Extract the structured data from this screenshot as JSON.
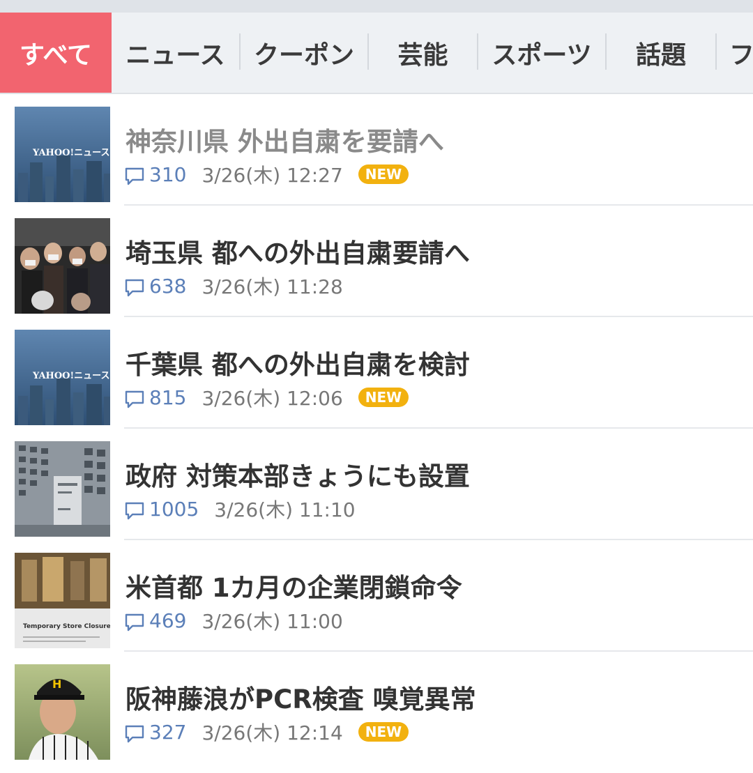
{
  "tabs": [
    {
      "label": "すべて",
      "active": true
    },
    {
      "label": "ニュース"
    },
    {
      "label": "クーポン"
    },
    {
      "label": "芸能"
    },
    {
      "label": "スポーツ"
    },
    {
      "label": "話題"
    },
    {
      "label": "フ"
    }
  ],
  "articles": [
    {
      "title": "神奈川県 外出自粛を要請へ",
      "comments": "310",
      "date": "3/26(木) 12:27",
      "badge": "NEW",
      "read": true,
      "thumb": "yahoo-news-city-thumbnail",
      "thumb_text": "YAHOO!ニュース"
    },
    {
      "title": "埼玉県 都への外出自粛要請へ",
      "comments": "638",
      "date": "3/26(木) 11:28",
      "badge": "",
      "read": false,
      "thumb": "crowd-photo-thumbnail"
    },
    {
      "title": "千葉県 都への外出自粛を検討",
      "comments": "815",
      "date": "3/26(木) 12:06",
      "badge": "NEW",
      "read": false,
      "thumb": "yahoo-news-city-thumbnail",
      "thumb_text": "YAHOO!ニュース"
    },
    {
      "title": "政府 対策本部きょうにも設置",
      "comments": "1005",
      "date": "3/26(木) 11:10",
      "badge": "",
      "read": false,
      "thumb": "government-building-thumbnail"
    },
    {
      "title": "米首都 1カ月の企業閉鎖命令",
      "comments": "469",
      "date": "3/26(木) 11:00",
      "badge": "",
      "read": false,
      "thumb": "store-closure-thumbnail",
      "thumb_text": "Temporary Store Closure"
    },
    {
      "title": "阪神藤浪がPCR検査 嗅覚異常",
      "comments": "327",
      "date": "3/26(木) 12:14",
      "badge": "NEW",
      "read": false,
      "thumb": "baseball-player-thumbnail"
    }
  ],
  "colors": {
    "active_tab": "#f2646f",
    "new_badge": "#f2b10f",
    "comment_count": "#5b7fb8"
  }
}
